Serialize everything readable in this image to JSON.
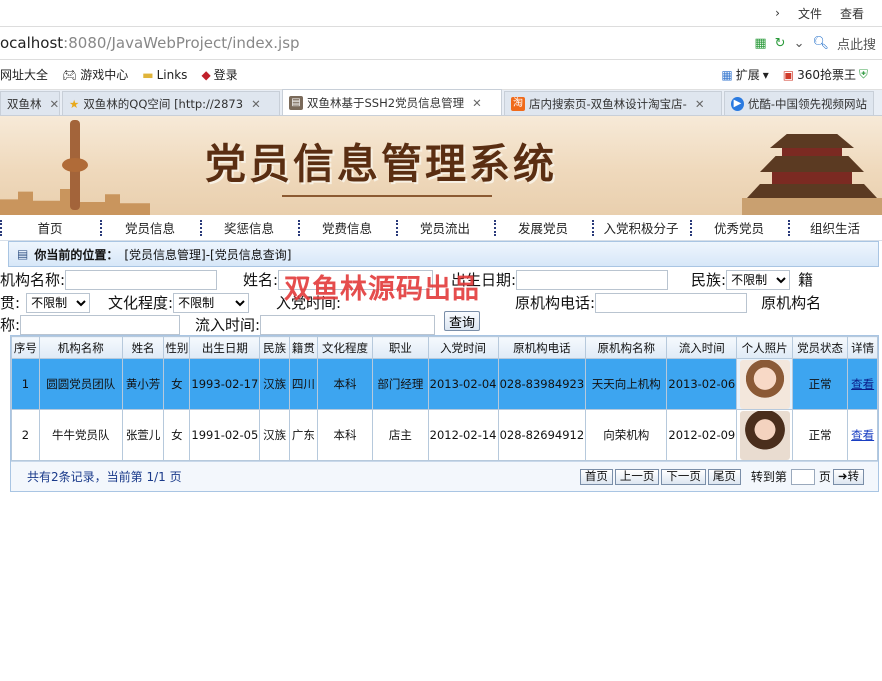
{
  "browser": {
    "menu": [
      "文件",
      "查看"
    ],
    "address": {
      "host": "ocalhost",
      "path": ":8080/JavaWebProject/index.jsp"
    },
    "search_label": "点此搜",
    "bookmarks": [
      "网址大全",
      "游戏中心",
      "Links",
      "登录"
    ],
    "ext": [
      "扩展",
      "360抢票王"
    ],
    "tabs": [
      {
        "title": "双鱼林",
        "active": false
      },
      {
        "title": "双鱼林的QQ空间 [http://2873",
        "active": false
      },
      {
        "title": "双鱼林基于SSH2党员信息管理",
        "active": true
      },
      {
        "title": "店内搜索页-双鱼林设计淘宝店-",
        "active": false
      },
      {
        "title": "优酷-中国领先视频网站",
        "active": false
      }
    ]
  },
  "banner": {
    "title": "党员信息管理系统"
  },
  "nav": [
    "首页",
    "党员信息",
    "奖惩信息",
    "党费信息",
    "党员流出",
    "发展党员",
    "入党积极分子",
    "优秀党员",
    "组织生活"
  ],
  "breadcrumb": {
    "label": "你当前的位置：",
    "path": "[党员信息管理]-[党员信息查询]"
  },
  "search": {
    "org_label": "机构名称:",
    "name_label": "姓名:",
    "birth_label": "出生日期:",
    "nation_label": "民族:",
    "nation_value": "不限制",
    "native_label_a": "籍",
    "native_label_b": "贯:",
    "native_value": "不限制",
    "edu_label": "文化程度:",
    "edu_value": "不限制",
    "join_label": "入党时间:",
    "orig_tel_label": "原机构电话:",
    "orig_name_label_a": "原机构名",
    "orig_name_label_b": "称:",
    "out_label": "流入时间:",
    "query_button": "查询"
  },
  "watermark": "双鱼林源码出品",
  "table": {
    "headers": [
      "序号",
      "机构名称",
      "姓名",
      "性别",
      "出生日期",
      "民族",
      "籍贯",
      "文化程度",
      "职业",
      "入党时间",
      "原机构电话",
      "原机构名称",
      "流入时间",
      "个人照片",
      "党员状态",
      "详情"
    ],
    "rows": [
      [
        "1",
        "圆圆党员团队",
        "黄小芳",
        "女",
        "1993-02-17",
        "汉族",
        "四川",
        "本科",
        "部门经理",
        "2013-02-04",
        "028-83984923",
        "天天向上机构",
        "2013-02-06",
        "",
        "正常",
        "查看"
      ],
      [
        "2",
        "牛牛党员队",
        "张萱儿",
        "女",
        "1991-02-05",
        "汉族",
        "广东",
        "本科",
        "店主",
        "2012-02-14",
        "028-82694912",
        "向荣机构",
        "2012-02-09",
        "",
        "正常",
        "查看"
      ]
    ]
  },
  "pager": {
    "info": "共有2条记录，当前第 1/1 页",
    "first": "首页",
    "prev": "上一页",
    "next": "下一页",
    "last": "尾页",
    "goto_label": "转到第",
    "page_unit": "页",
    "go_button": "➜转"
  }
}
